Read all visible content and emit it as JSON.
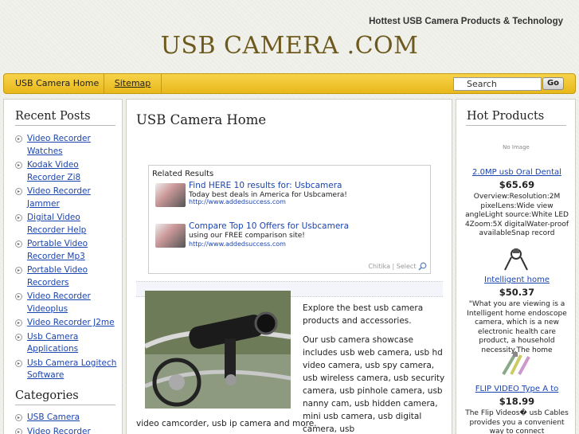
{
  "header": {
    "tagline": "Hottest USB Camera Products & Technology",
    "logo": "USB CAMERA .COM"
  },
  "nav": {
    "home": "USB Camera Home",
    "sitemap": "Sitemap",
    "search_value": "Search",
    "go_label": "Go"
  },
  "sidebar": {
    "recent_heading": "Recent Posts",
    "recent_posts": [
      [
        "Video Recorder",
        "Watches"
      ],
      [
        "Kodak Video",
        "Recorder Zi8"
      ],
      [
        "Video Recorder",
        "Jammer"
      ],
      [
        "Digital Video",
        "Recorder Help"
      ],
      [
        "Portable Video",
        "Recorder Mp3"
      ],
      [
        "Portable Video",
        "Recorders"
      ],
      [
        "Video Recorder",
        "Videoplus"
      ],
      [
        "Video Recorder J2me"
      ],
      [
        "Usb Camera",
        "Applications"
      ],
      [
        "Usb Camera Logitech",
        "Software"
      ]
    ],
    "categories_heading": "Categories",
    "categories": [
      "USB Camera",
      "Video Recorder"
    ]
  },
  "main": {
    "title": "USB Camera Home",
    "related_title": "Related Results",
    "ads": [
      {
        "link": "Find HERE 10 results for: Usbcamera",
        "desc": "Today best deals in America for Usbcamera!",
        "url": "http://www.addedsuccess.com"
      },
      {
        "link": "Compare Top 10 Offers for Usbcamera",
        "desc": "using our FREE comparison site!",
        "url": "http://www.addedsuccess.com"
      }
    ],
    "chitika": "Chitika | Select",
    "intro": "Explore the best usb camera products and accessories.",
    "body": "Our usb camera showcase includes usb web camera, usb hd video camera, usb spy camera, usb wireless camera, usb security camera, usb pinhole camera, usb nanny cam, usb hidden camera, mini usb camera, usb digital camera, usb",
    "body_tail": "video camcorder, usb ip camera and more."
  },
  "hot": {
    "heading": "Hot Products",
    "no_image": "No Image",
    "products": [
      {
        "link": "2.0MP usb Oral Dental",
        "price": "$65.69",
        "desc": "Overview:Resolution:2M pixelLens:Wide view angleLight source:White LED 4Zoom:5X digitalWater-proof availableSnap record"
      },
      {
        "link": "Intelligent home",
        "price": "$50.37",
        "desc": "\"What you are viewing is a Intelligent home endoscope camera, which is a new electronic health care product, a household necessity.The home"
      },
      {
        "link": "FLIP VIDEO Type A to",
        "price": "$18.99",
        "desc": "The Flip Videos� usb Cables provides you a convenient way to connect"
      }
    ]
  },
  "colors": {
    "logo": "#6e5a1e",
    "nav_bar": "#f0c530",
    "link": "#1a44b0"
  }
}
